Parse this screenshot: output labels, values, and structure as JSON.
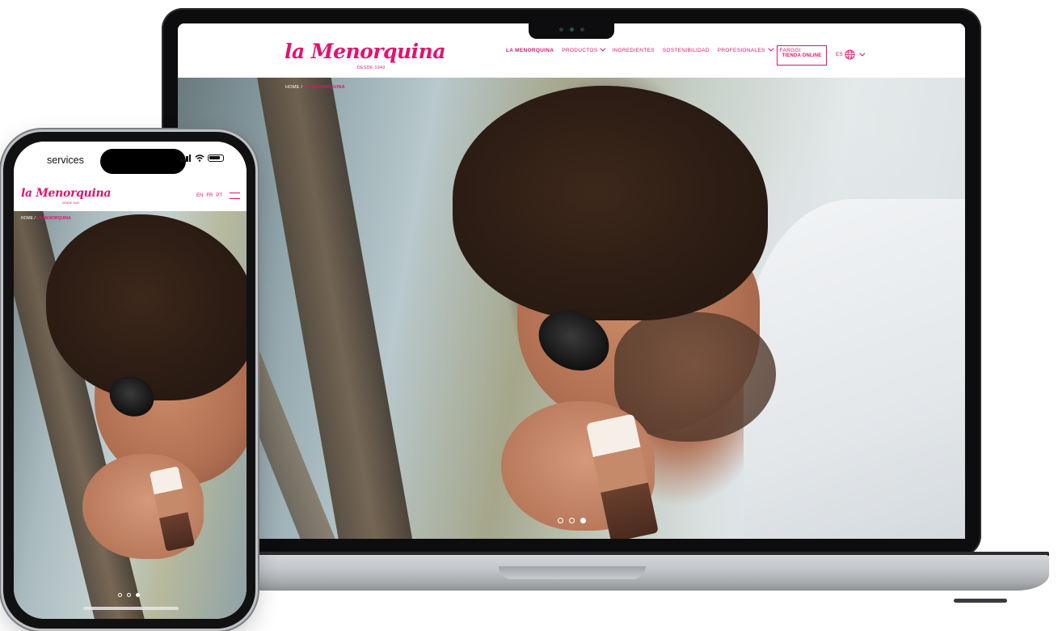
{
  "desktop": {
    "logo": {
      "text": "la Menorquina",
      "subtitle": "DESDE 1940"
    },
    "nav": {
      "items": [
        {
          "label": "LA MENORQUINA",
          "active": true,
          "dropdown": false
        },
        {
          "label": "PRODUCTOS",
          "active": false,
          "dropdown": true
        },
        {
          "label": "INGREDIENTES",
          "active": false,
          "dropdown": false
        },
        {
          "label": "SOSTENIBILIDAD",
          "active": false,
          "dropdown": false
        },
        {
          "label": "PROFESIONALES",
          "active": false,
          "dropdown": true
        },
        {
          "label": "FARGGI",
          "active": false,
          "dropdown": false
        }
      ],
      "cta_label": "TIENDA ONLINE",
      "language": "ES"
    },
    "breadcrumb": {
      "home": "HOME",
      "separator": "/",
      "current": "LA MENORQUINA"
    },
    "slider": {
      "count": 3,
      "active_index": 2
    }
  },
  "mobile": {
    "status_bar": {
      "time": "services"
    },
    "logo": {
      "text": "la Menorquina",
      "subtitle": "DESDE 1940"
    },
    "languages": [
      "EN",
      "FR",
      "PT"
    ],
    "breadcrumb": {
      "home": "HOME",
      "separator": "/",
      "current": "LA MENORQUINA"
    },
    "slider": {
      "count": 3,
      "active_index": 2
    }
  },
  "colors": {
    "brand": "#e2136e",
    "laptop_frame": "#0d0d0f",
    "base_silver": "#c3c6ca"
  },
  "icons": [
    "globe-icon",
    "chevron-down-icon",
    "hamburger-icon",
    "signal-icon",
    "wifi-icon",
    "battery-icon",
    "camera-icon"
  ]
}
